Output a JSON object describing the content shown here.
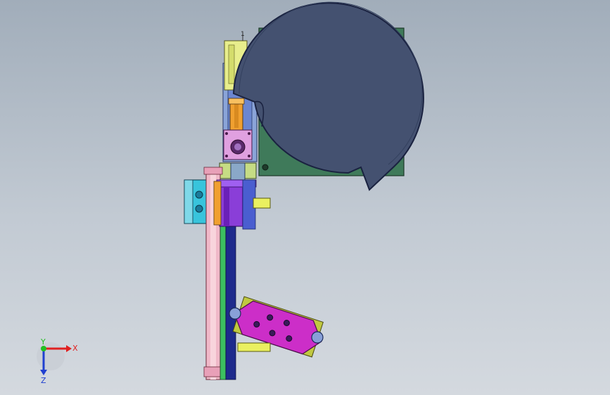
{
  "viewport": {
    "background_top": "#a1adba",
    "background_bottom": "#d4d9df"
  },
  "model": {
    "part_marker": "1",
    "colors": {
      "bowl": "#445170",
      "base_plate": "#3f7a5a",
      "frame_blue": "#4a5ed0",
      "purple_block": "#8a3ed8",
      "magenta_plate": "#cc2ec8",
      "yellow": "#eaf060",
      "lime": "#c6dc84",
      "cyan_block": "#38c4dc",
      "pink_rail": "#f0b8c8",
      "orange_slide": "#f0a030",
      "navy_column": "#1e2a8c",
      "green_rail": "#3cc060"
    }
  },
  "triad": {
    "x_label": "X",
    "y_label": "Y",
    "z_label": "Z",
    "x_color": "#e02020",
    "y_color": "#20c020",
    "z_color": "#2040d0"
  }
}
